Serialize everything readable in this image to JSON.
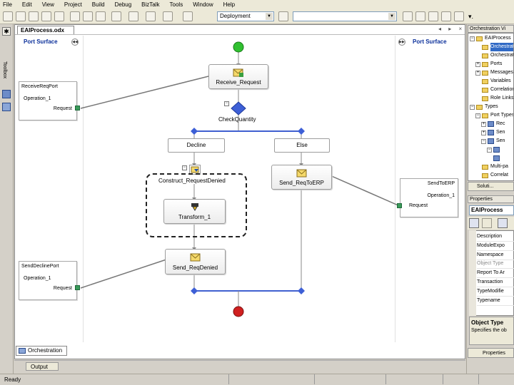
{
  "menu": [
    "File",
    "Edit",
    "View",
    "Project",
    "Build",
    "Debug",
    "BizTalk",
    "Tools",
    "Window",
    "Help"
  ],
  "toolbar": {
    "config_value": "Deployment",
    "search_value": ""
  },
  "toolbox": {
    "label": "Toolbox"
  },
  "document": {
    "tab_title": "EAIProcess.odx",
    "controls": "◂ ▸ ×"
  },
  "port_surface": {
    "left_label": "Port Surface",
    "right_label": "Port Surface"
  },
  "ports": {
    "receive": {
      "name": "ReceiveReqPort",
      "operation": "Operation_1",
      "message": "Request"
    },
    "decline": {
      "name": "SendDeclinePort",
      "operation": "Operation_1",
      "message": "Request"
    },
    "erp": {
      "name": "SendToERP",
      "operation": "Operation_1",
      "message": "Request"
    }
  },
  "shapes": {
    "receive": "Receive_Request",
    "decide": "CheckQuantity",
    "branch_decline": "Decline",
    "branch_else": "Else",
    "construct": "Construct_RequestDenied",
    "transform": "Transform_1",
    "send_denied": "Send_ReqDenied",
    "send_erp": "Send_ReqToERP"
  },
  "collapse_glyph": "−",
  "designer_tab": "Orchestration",
  "output_tab": "Output",
  "status": "Ready",
  "orchestration_view": {
    "title": "Orchestration Vi",
    "items": [
      {
        "label": "EAIProcess",
        "indent": 0,
        "expander": "−"
      },
      {
        "label": "Orchestrat",
        "indent": 1,
        "expander": "",
        "selected": true
      },
      {
        "label": "Orchestrat",
        "indent": 1,
        "expander": ""
      },
      {
        "label": "Ports",
        "indent": 1,
        "expander": "+"
      },
      {
        "label": "Messages",
        "indent": 1,
        "expander": "+"
      },
      {
        "label": "Variables",
        "indent": 1,
        "expander": ""
      },
      {
        "label": "Correlation",
        "indent": 1,
        "expander": ""
      },
      {
        "label": "Role Links",
        "indent": 1,
        "expander": ""
      },
      {
        "label": "Types",
        "indent": 0,
        "expander": "−"
      },
      {
        "label": "Port Types",
        "indent": 1,
        "expander": "−"
      },
      {
        "label": "Rec",
        "indent": 2,
        "expander": "+"
      },
      {
        "label": "Sen",
        "indent": 2,
        "expander": "+"
      },
      {
        "label": "Sen",
        "indent": 2,
        "expander": "−"
      },
      {
        "label": "",
        "indent": 3,
        "expander": "−"
      },
      {
        "label": "",
        "indent": 3,
        "expander": ""
      },
      {
        "label": "Multi-pa",
        "indent": 1,
        "expander": ""
      },
      {
        "label": "Correlat",
        "indent": 1,
        "expander": ""
      }
    ],
    "tabs_label": "Soluti..."
  },
  "properties": {
    "title": "Properties",
    "object": "EAIProcess",
    "rows": [
      "Description",
      "ModuleExpo",
      "Namespace",
      "Object Type",
      "Report To Ar",
      "Transaction",
      "TypeModifie",
      "Typename"
    ],
    "desc_title": "Object Type",
    "desc_text": "Specifies the ob",
    "tab_label": "Properties"
  }
}
